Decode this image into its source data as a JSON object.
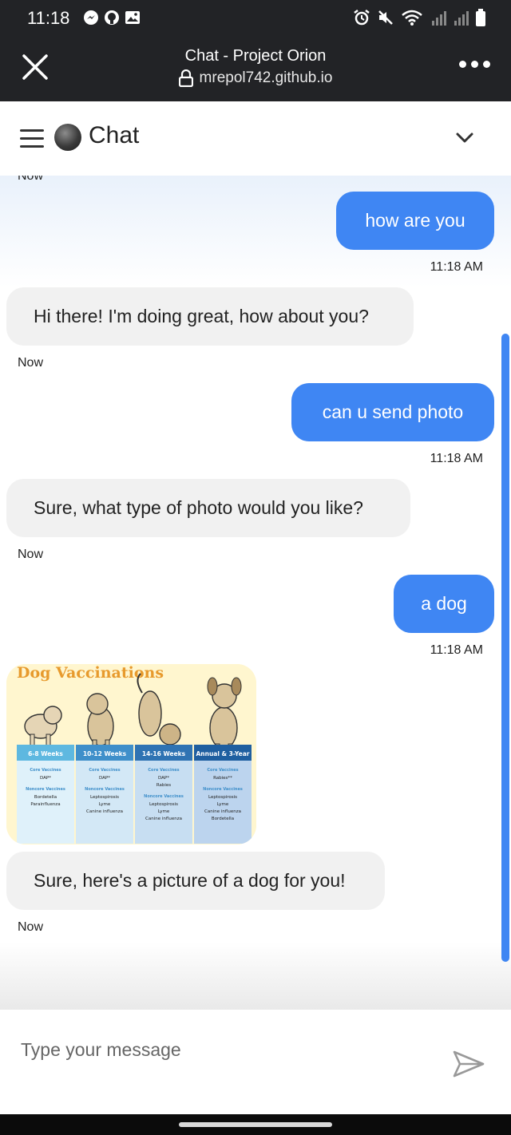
{
  "status_bar": {
    "time": "11:18"
  },
  "browser": {
    "title": "Chat - Project Orion",
    "url": "mrepol742.github.io"
  },
  "header": {
    "title": "Chat"
  },
  "chat": {
    "cut_timestamp": "Now",
    "messages": [
      {
        "role": "user",
        "text": "how are you",
        "time": "11:18 AM"
      },
      {
        "role": "bot",
        "text": "Hi there! I'm doing great, how about you?",
        "time": "Now"
      },
      {
        "role": "user",
        "text": "can u send photo",
        "time": "11:18 AM"
      },
      {
        "role": "bot",
        "text": "Sure, what type of photo would you like?",
        "time": "Now"
      },
      {
        "role": "user",
        "text": "a dog",
        "time": "11:18 AM"
      },
      {
        "role": "bot",
        "text": "Sure, here's a picture of a dog for you!",
        "time": "Now"
      }
    ],
    "image": {
      "title": "Dog Vaccinations",
      "columns": [
        {
          "header": "6-8 Weeks",
          "sections": [
            {
              "title": "Core Vaccines",
              "items": [
                "DAP*"
              ]
            },
            {
              "title": "Noncore Vaccines",
              "items": [
                "Bordetella",
                "Parainfluenza"
              ]
            }
          ]
        },
        {
          "header": "10-12 Weeks",
          "sections": [
            {
              "title": "Core Vaccines",
              "items": [
                "DAP*"
              ]
            },
            {
              "title": "Noncore Vaccines",
              "items": [
                "Leptospirosis",
                "Lyme",
                "Canine influenza"
              ]
            }
          ]
        },
        {
          "header": "14-16 Weeks",
          "sections": [
            {
              "title": "Core Vaccines",
              "items": [
                "DAP*",
                "Rabies"
              ]
            },
            {
              "title": "Noncore Vaccines",
              "items": [
                "Leptospirosis",
                "Lyme",
                "Canine influenza"
              ]
            }
          ]
        },
        {
          "header": "Annual & 3-Year",
          "sections": [
            {
              "title": "Core Vaccines",
              "items": [
                "Rabies**"
              ]
            },
            {
              "title": "Noncore Vaccines",
              "items": [
                "Leptospirosis",
                "Lyme",
                "Canine influenza",
                "Bordetella"
              ]
            }
          ]
        }
      ]
    }
  },
  "input": {
    "placeholder": "Type your message"
  },
  "colors": {
    "accent": "#3f86f3",
    "bot_bubble": "#f1f1f1",
    "status_bar": "#222326"
  }
}
